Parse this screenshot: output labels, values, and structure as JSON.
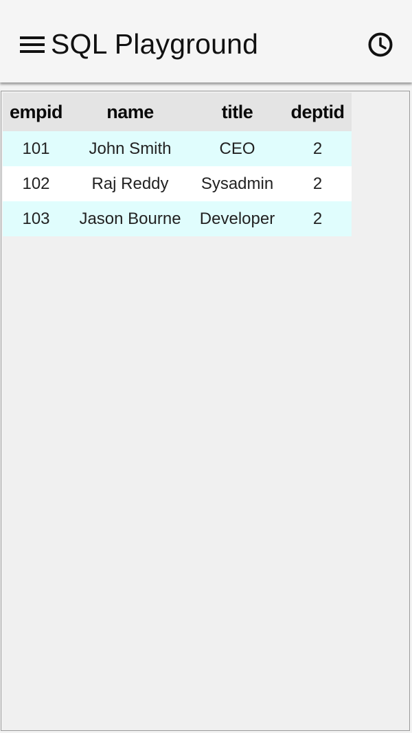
{
  "app_bar": {
    "title": "SQL Playground",
    "menu_icon": "hamburger-menu-icon",
    "history_icon": "clock-history-icon"
  },
  "results": {
    "columns": [
      "empid",
      "name",
      "title",
      "deptid"
    ],
    "rows": [
      [
        "101",
        "John Smith",
        "CEO",
        "2"
      ],
      [
        "102",
        "Raj Reddy",
        "Sysadmin",
        "2"
      ],
      [
        "103",
        "Jason Bourne",
        "Developer",
        "2"
      ]
    ]
  },
  "colors": {
    "header_bg": "#e4e4e4",
    "row_odd_bg": "#e0fdfd",
    "row_even_bg": "#ffffff",
    "app_bar_bg": "#f5f5f5"
  }
}
